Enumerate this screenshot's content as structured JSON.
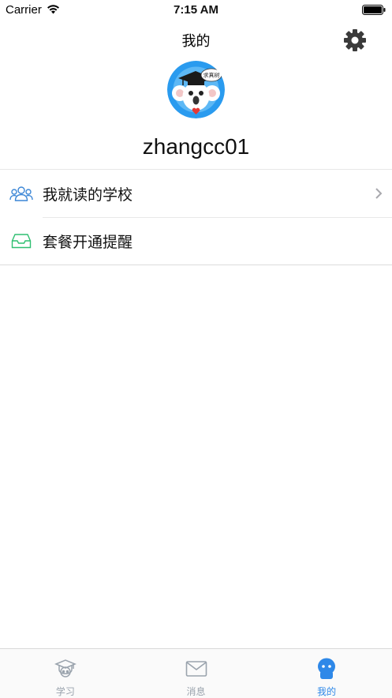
{
  "status_bar": {
    "carrier": "Carrier",
    "time": "7:15 AM"
  },
  "nav": {
    "title": "我的",
    "settings_icon": "gear-icon"
  },
  "profile": {
    "username": "zhangcc01",
    "avatar_badge": "求真树"
  },
  "menu": {
    "items": [
      {
        "label": "我就读的学校",
        "icon": "people-icon",
        "has_chevron": true
      },
      {
        "label": "套餐开通提醒",
        "icon": "inbox-icon",
        "has_chevron": false
      }
    ]
  },
  "tabs": [
    {
      "label": "学习",
      "icon": "graduation-cap-icon",
      "active": false
    },
    {
      "label": "消息",
      "icon": "envelope-icon",
      "active": false
    },
    {
      "label": "我的",
      "icon": "person-icon",
      "active": true
    }
  ],
  "colors": {
    "accent": "#2e88e8",
    "inactive": "#9aa3ad",
    "inbox_icon": "#2fbf71"
  }
}
